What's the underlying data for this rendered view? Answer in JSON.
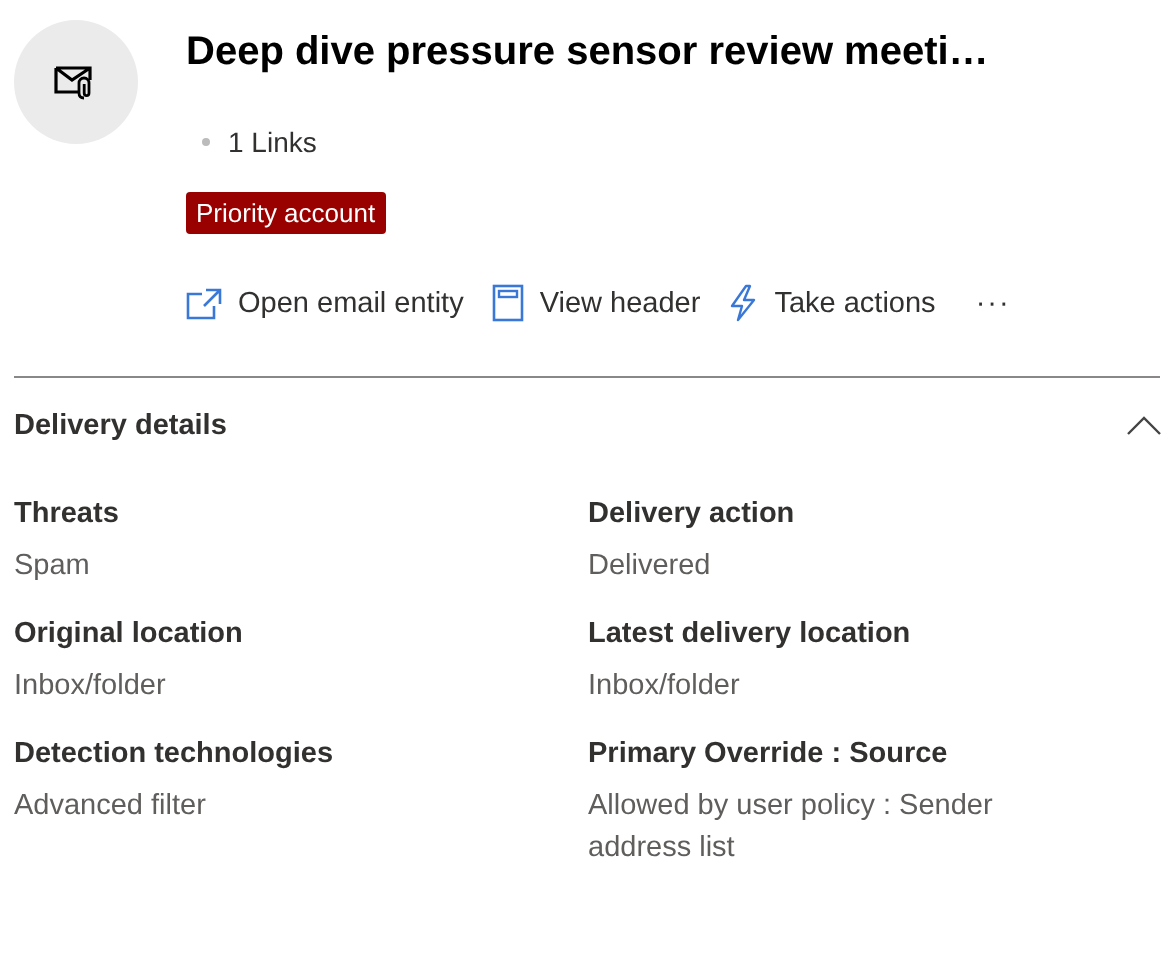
{
  "header": {
    "title": "Deep dive pressure sensor review meeti…",
    "links": "1 Links",
    "badge": "Priority account"
  },
  "actions": [
    {
      "kind": "open",
      "label": "Open email entity"
    },
    {
      "kind": "header",
      "label": "View header"
    },
    {
      "kind": "bolt",
      "label": "Take actions"
    },
    {
      "kind": "more",
      "label": "···"
    }
  ],
  "section": {
    "title": "Delivery details",
    "expanded": true,
    "fields": [
      {
        "label": "Threats",
        "value": "Spam"
      },
      {
        "label": "Delivery action",
        "value": "Delivered"
      },
      {
        "label": "Original location",
        "value": "Inbox/folder"
      },
      {
        "label": "Latest delivery location",
        "value": "Inbox/folder"
      },
      {
        "label": "Detection technologies",
        "value": "Advanced filter"
      },
      {
        "label": "Primary Override : Source",
        "value": "Allowed by user policy : Sender address list"
      }
    ]
  }
}
